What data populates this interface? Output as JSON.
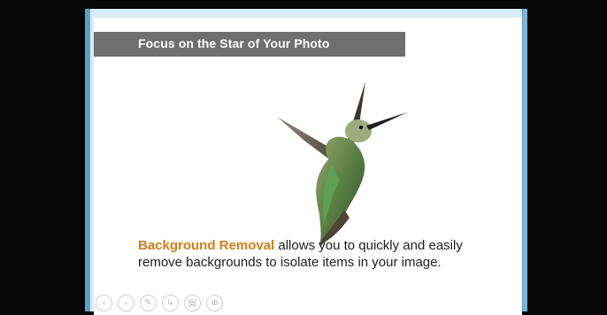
{
  "slide": {
    "title": "Focus on the Star of Your Photo",
    "caption_highlight": "Background Removal",
    "caption_rest": " allows you to quickly and easily remove backgrounds to isolate items in your image.",
    "accent_color": "#d77b17"
  },
  "toolbar": {
    "buttons": [
      {
        "name": "previous-slide-button",
        "icon": "previous-icon",
        "glyph": "‹"
      },
      {
        "name": "next-slide-button",
        "icon": "next-icon",
        "glyph": "›"
      },
      {
        "name": "pen-button",
        "icon": "pen-icon",
        "glyph": "✎"
      },
      {
        "name": "pointer-button",
        "icon": "pointer-icon",
        "glyph": "↳"
      },
      {
        "name": "slides-button",
        "icon": "slides-icon",
        "glyph": "▤"
      },
      {
        "name": "zoom-button",
        "icon": "zoom-icon",
        "glyph": "⊕"
      }
    ]
  }
}
